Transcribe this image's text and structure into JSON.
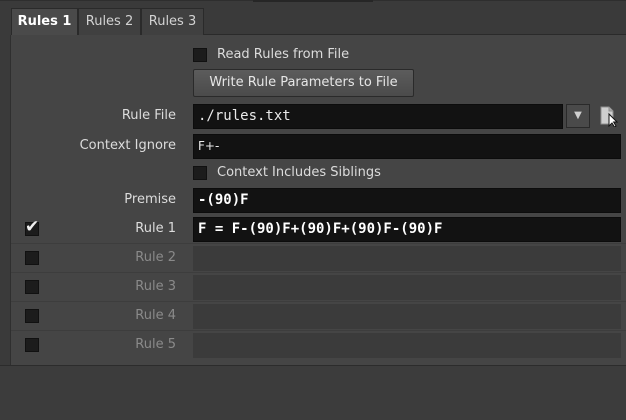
{
  "tabs": [
    {
      "label": "Rules 1",
      "active": true
    },
    {
      "label": "Rules 2",
      "active": false
    },
    {
      "label": "Rules 3",
      "active": false
    }
  ],
  "read_rules": {
    "label": "Read Rules from File",
    "checked": false
  },
  "write_button": {
    "label": "Write Rule Parameters to File"
  },
  "rule_file": {
    "label": "Rule File",
    "value": "./rules.txt",
    "dropdown_icon": "triangle-down-icon",
    "browse_icon": "file-browse-icon"
  },
  "context_ignore": {
    "label": "Context Ignore",
    "value": "F+-"
  },
  "context_siblings": {
    "label": "Context Includes Siblings",
    "checked": false
  },
  "premise": {
    "label": "Premise",
    "value": "-(90)F"
  },
  "rules": [
    {
      "label": "Rule 1",
      "enabled": true,
      "value": "F = F-(90)F+(90)F+(90)F-(90)F"
    },
    {
      "label": "Rule 2",
      "enabled": false,
      "value": ""
    },
    {
      "label": "Rule 3",
      "enabled": false,
      "value": ""
    },
    {
      "label": "Rule 4",
      "enabled": false,
      "value": ""
    },
    {
      "label": "Rule 5",
      "enabled": false,
      "value": ""
    }
  ],
  "colors": {
    "background": "#3a3a3a",
    "panel": "#454545",
    "field": "#121212",
    "text": "#dcdcdc",
    "disabled_text": "#8a8a8a"
  }
}
